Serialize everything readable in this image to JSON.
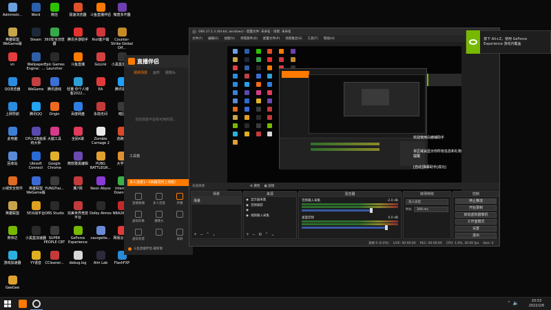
{
  "desktop": {
    "icons": [
      {
        "label": "Administr...",
        "color": "#6aa0e0"
      },
      {
        "label": "Word",
        "color": "#2b5faa"
      },
      {
        "label": "微信",
        "color": "#2dc100"
      },
      {
        "label": "极速浏览器",
        "color": "#e0502a"
      },
      {
        "label": "斗鱼直播伴侣",
        "color": "#ff7a00"
      },
      {
        "label": "微唐多开器",
        "color": "#6f3fb0"
      },
      {
        "label": "英雄联盟WeGame版",
        "color": "#c9a44a"
      },
      {
        "label": "Steam",
        "color": "#1b2838"
      },
      {
        "label": "360安全浏览器",
        "color": "#36a94a"
      },
      {
        "label": "腾讯手游助手",
        "color": "#e5322d"
      },
      {
        "label": "Riot客户端",
        "color": "#d1363a"
      },
      {
        "label": "Counter-Strike Global Off...",
        "color": "#c48a2a"
      },
      {
        "label": "vn",
        "color": "#e33d3d"
      },
      {
        "label": "Wallpaper Engine：...",
        "color": "#2f5fa4"
      },
      {
        "label": "Epic Games Launcher",
        "color": "#2a2a2a"
      },
      {
        "label": "斗鱼直播",
        "color": "#ff7a00"
      },
      {
        "label": "GoLink",
        "color": "#d24040"
      },
      {
        "label": "小黑盒加速器",
        "color": "#333333"
      },
      {
        "label": "QQ浏览器",
        "color": "#2a8ce0"
      },
      {
        "label": "WeGame",
        "color": "#c24040"
      },
      {
        "label": "腾讯游戏",
        "color": "#3b6fd6"
      },
      {
        "label": "轻量 你个人博客2022...",
        "color": "#2ea0d6"
      },
      {
        "label": "EA",
        "color": "#e23a3a"
      },
      {
        "label": "腾讯视频",
        "color": "#20a0ff"
      },
      {
        "label": "上网导航",
        "color": "#2a8ce0"
      },
      {
        "label": "腾讯QQ",
        "color": "#22a4ef"
      },
      {
        "label": "Origin",
        "color": "#f26b1d"
      },
      {
        "label": "百度网盘",
        "color": "#2f7de1"
      },
      {
        "label": "永劫无间",
        "color": "#c43a3a"
      },
      {
        "label": "暗区",
        "color": "#3a3a3a"
      },
      {
        "label": "此电脑",
        "color": "#3d7fd6"
      },
      {
        "label": "CPU-Z高级系统大师",
        "color": "#5a4ab0"
      },
      {
        "label": "大腿工具",
        "color": "#d63a8a"
      },
      {
        "label": "全民K歌",
        "color": "#e23a5a"
      },
      {
        "label": "Zombie Carnage 2",
        "color": "#e8e8e8"
      },
      {
        "label": "逃跑吧",
        "color": "#d64a2a"
      },
      {
        "label": "回收站",
        "color": "#5a8ad6"
      },
      {
        "label": "Ubisoft Connect",
        "color": "#2a6ad6"
      },
      {
        "label": "Google Chrome",
        "color": "#e0b02a"
      },
      {
        "label": "微软雅黑编辑",
        "color": "#6a4ab0"
      },
      {
        "label": "PUBG BATTLEGR...",
        "color": "#e0a030"
      },
      {
        "label": "大学...",
        "color": "#e09030"
      },
      {
        "label": "火绒安全软件",
        "color": "#e06a20"
      },
      {
        "label": "英雄联盟WeGame版",
        "color": "#3a6ad6"
      },
      {
        "label": "YUNGTrai...",
        "color": "#3a3a3a"
      },
      {
        "label": "鹰7网",
        "color": "#c43a3a"
      },
      {
        "label": "Neon Abyss",
        "color": "#8a3ad6"
      },
      {
        "label": "Internet Downlo...",
        "color": "#3ab04a"
      },
      {
        "label": "英雄联盟",
        "color": "#c9a44a"
      },
      {
        "label": "5E对战平台",
        "color": "#e0a020"
      },
      {
        "label": "OBS Studio",
        "color": "#2a2a2a"
      },
      {
        "label": "完美世界竞技平台",
        "color": "#c43a3a"
      },
      {
        "label": "Dolby Atmos",
        "color": "#2a2a2a"
      },
      {
        "label": "NBA2KOL2",
        "color": "#c42a2a"
      },
      {
        "label": "英伟达",
        "color": "#76b900"
      },
      {
        "label": "小黑盒加速器",
        "color": "#2a2a2a"
      },
      {
        "label": "SUPER PEOPLE CBT",
        "color": "#3a3a3a"
      },
      {
        "label": "GeForce Experience",
        "color": "#76b900"
      },
      {
        "label": "caurgette...",
        "color": "#6a8ad6"
      },
      {
        "label": "网易云音乐",
        "color": "#e23a3a"
      },
      {
        "label": "游戏加速器",
        "color": "#2ab0e0"
      },
      {
        "label": "YY语音",
        "color": "#e0b020"
      },
      {
        "label": "CCleaner...",
        "color": "#c43a3a"
      },
      {
        "label": "debug.log",
        "color": "#d8d8d8"
      },
      {
        "label": "Aim Lab",
        "color": "#2a2a3a"
      },
      {
        "label": "FlashFXP",
        "color": "#2a8ad6"
      },
      {
        "label": "GeeGee",
        "color": "#e0a030"
      }
    ]
  },
  "nvidia_toast": {
    "text": "按下 Alt+Z，使用 GeForce Experience 游戏内覆盖"
  },
  "douyu": {
    "logo": "直播伴侣",
    "tabs": [
      "视频场景",
      "画布",
      "摄像头"
    ],
    "empty_hint": "当前场景中没有可用的源...",
    "tools_title": "工具箱",
    "banner": "多人连麦1~3四路同时上线啦！",
    "tools": [
      "直播备播",
      "多人连麦",
      "开播",
      "虚拟形象",
      "摄像头",
      "",
      "虚拟背景",
      "",
      "录屏"
    ],
    "status": "斗鱼直播伴侣-最新版"
  },
  "obs": {
    "title": "OBS 27.1.3 (64-bit, windows) - 配置文件: 未命名 - 场景: 未命名",
    "menu": [
      "文件(F)",
      "编辑(E)",
      "视图(V)",
      "停靠部件(D)",
      "配置文件(P)",
      "场景集合(S)",
      "工具(T)",
      "帮助(H)"
    ],
    "notifications": [
      "欢迎使用白鹿辅助手",
      "本区域会显示你所有信息和礼物提醒",
      "[自动]弹幕助手[成功]"
    ],
    "source_bar_label": "未选择源",
    "source_bar_buttons": [
      "属性",
      "滤镜"
    ],
    "scenes": {
      "header": "场景",
      "items": [
        "场景"
      ]
    },
    "sources": {
      "header": "来源",
      "items": [
        "显示器采集",
        "音频捕获",
        "",
        "视频输入采集"
      ]
    },
    "mixer": {
      "header": "混音器",
      "channels": [
        {
          "name": "音频输入采集",
          "db": "-2.0 dB",
          "level": 0.72
        },
        {
          "name": "桌面音频",
          "db": "0.0 dB",
          "level": 0.88
        }
      ]
    },
    "transitions": {
      "header": "转场特效",
      "type": "淡入淡出",
      "duration_label": "时长",
      "duration": "300 ms"
    },
    "controls": {
      "header": "控制",
      "buttons": [
        "停止推流",
        "开始录制",
        "启动虚拟摄像机",
        "工作室模式",
        "设置",
        "退出"
      ]
    },
    "status": {
      "dropped": "丢帧 0 (0.0%)",
      "live": "LIVE: 00:00:00",
      "rec": "REC: 00:00:00",
      "cpu": "CPU: 1.6%, 30.00 fps",
      "kbps": "kb/s: 0"
    }
  },
  "taskbar": {
    "time": "20:53",
    "date": "2022/2/6"
  },
  "colors": {
    "accent_orange": "#ff7a00",
    "obs_bg": "#1f1f1f",
    "nvidia": "#76b900"
  }
}
